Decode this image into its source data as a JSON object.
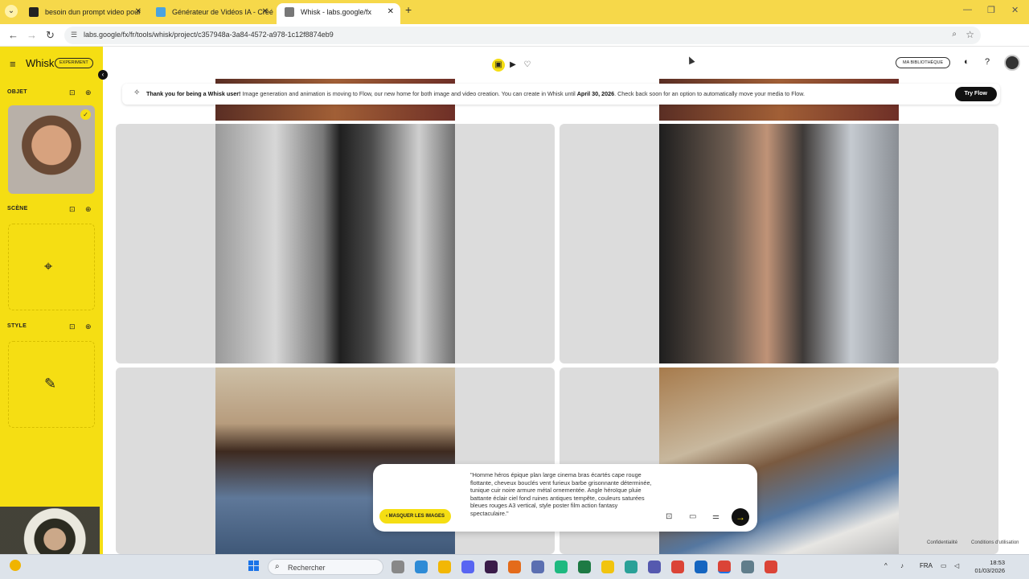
{
  "browser": {
    "tabs": [
      {
        "title": "besoin dun prompt video pour",
        "color": "#222"
      },
      {
        "title": "Générateur de Vidéos IA - Créé",
        "color": "#4aa3df"
      },
      {
        "title": "Whisk - labs.google/fx",
        "color": "#666"
      }
    ],
    "url": "labs.google/fx/fr/tools/whisk/project/c357948a-3a84-4572-a978-1c12f8874eb9"
  },
  "app": {
    "logo": "Whisk",
    "badge": "EXPERIMENT",
    "sections": {
      "object": "OBJET",
      "scene": "SCÈNE",
      "style": "STYLE"
    },
    "library_button": "MA BIBLIOTHÈQUE"
  },
  "banner": {
    "lead": "Thank you for being a Whisk user!",
    "text": " Image generation and animation is moving to Flow, our new home for both image and video creation. You can create in Whisk until ",
    "date": "April 30, 2026",
    "tail": ". Check back soon for an option to automatically move your media to Flow.",
    "cta": "Try Flow"
  },
  "prompt": {
    "text": "\"Homme héros épique plan large cinema bras écartés cape rouge flottante, cheveux bouclés vent furieux barbe grisonnante déterminée, tunique cuir noire armure métal ornementée. Angle héroïque pluie battante éclair ciel fond ruines antiques tempête, couleurs saturées bleues rouges A3 vertical, style poster film action fantasy spectaculaire.\"",
    "hide_button": "MASQUER LES IMAGES"
  },
  "footer": {
    "privacy": "Confidentialité",
    "terms": "Conditions d'utilisation"
  },
  "taskbar": {
    "search": "Rechercher",
    "lang": "FRA",
    "time": "18:53",
    "date": "01/03/2026"
  }
}
